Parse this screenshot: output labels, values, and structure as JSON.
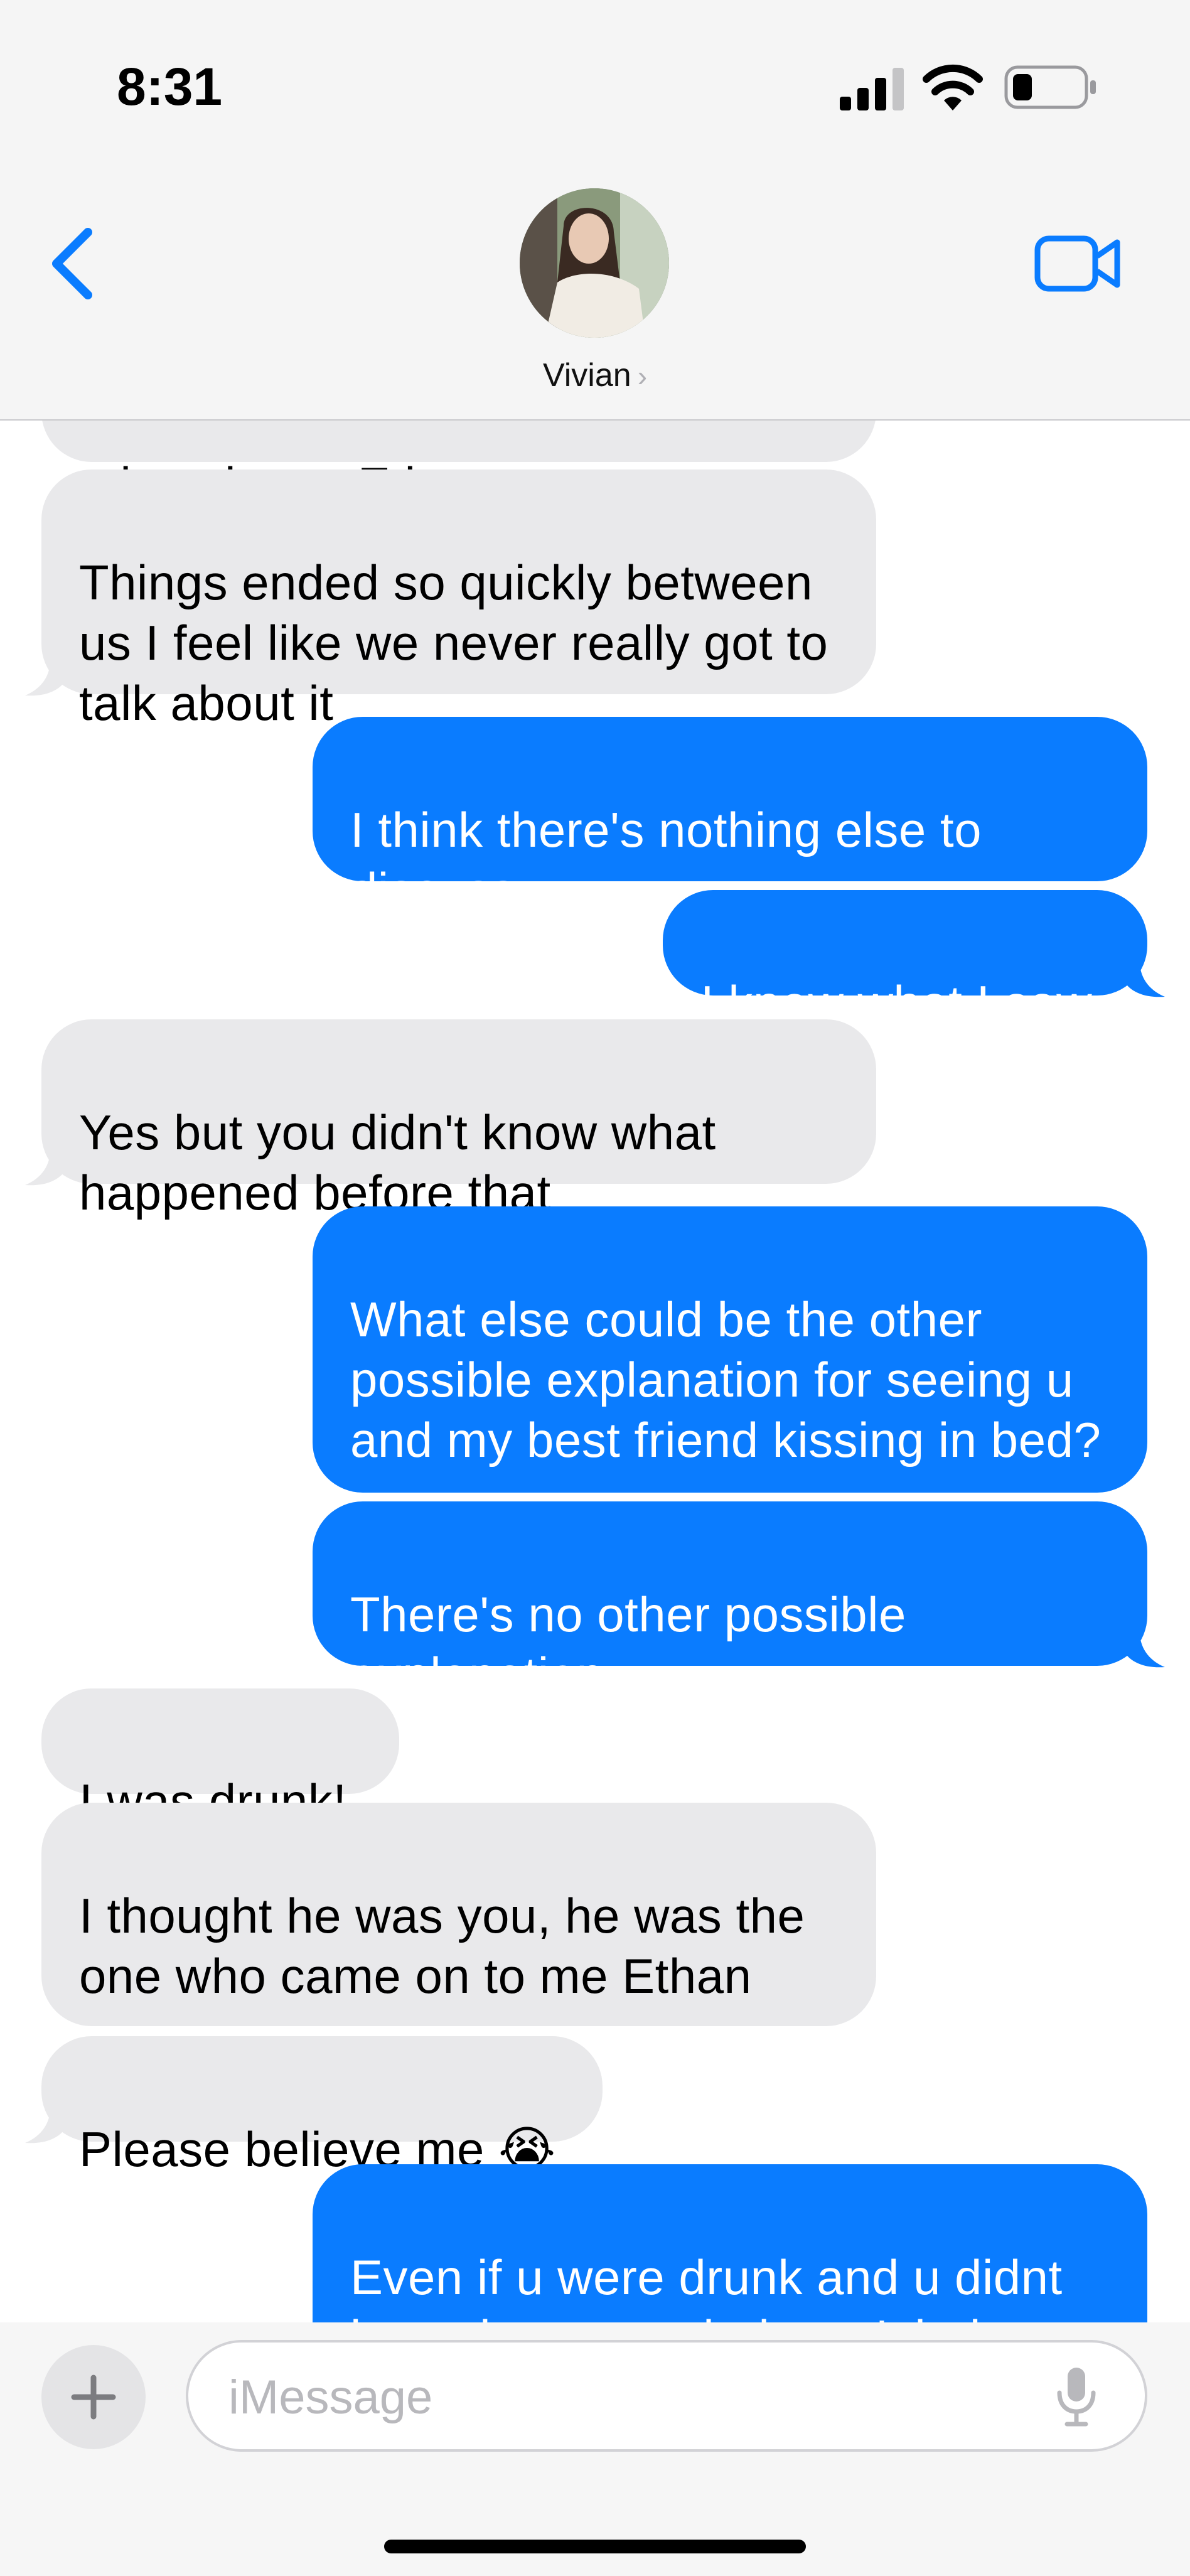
{
  "status_bar": {
    "time": "8:31"
  },
  "header": {
    "contact_name": "Vivian",
    "back_icon": "chevron-left-icon",
    "video_icon": "video-camera-icon"
  },
  "colors": {
    "sent_bubble": "#0a7cff",
    "received_bubble": "#e9e9eb",
    "accent": "#0a7cff"
  },
  "messages": [
    {
      "sender": "them",
      "text": "missed you, Ethan"
    },
    {
      "sender": "them",
      "text": "Things ended so quickly between us I feel like we never really got to talk about it"
    },
    {
      "sender": "me",
      "text": "I think there's nothing else to discuss"
    },
    {
      "sender": "me",
      "text": "I know what I saw"
    },
    {
      "sender": "them",
      "text": "Yes but you didn't know what happened before that"
    },
    {
      "sender": "me",
      "text": "What else could be the other possible explanation for seeing u and my best friend kissing in bed?"
    },
    {
      "sender": "me",
      "text": "There's no other possible explanation"
    },
    {
      "sender": "them",
      "text": "I was drunk!"
    },
    {
      "sender": "them",
      "text": "I thought he was you, he was the one who came on to me Ethan"
    },
    {
      "sender": "them",
      "text": "Please believe me 😭"
    },
    {
      "sender": "me",
      "text": "Even if u were drunk and u didnt know it was me it doesn't help"
    }
  ],
  "input_bar": {
    "placeholder": "iMessage",
    "value": "",
    "plus_icon": "plus-icon",
    "mic_icon": "microphone-icon"
  }
}
